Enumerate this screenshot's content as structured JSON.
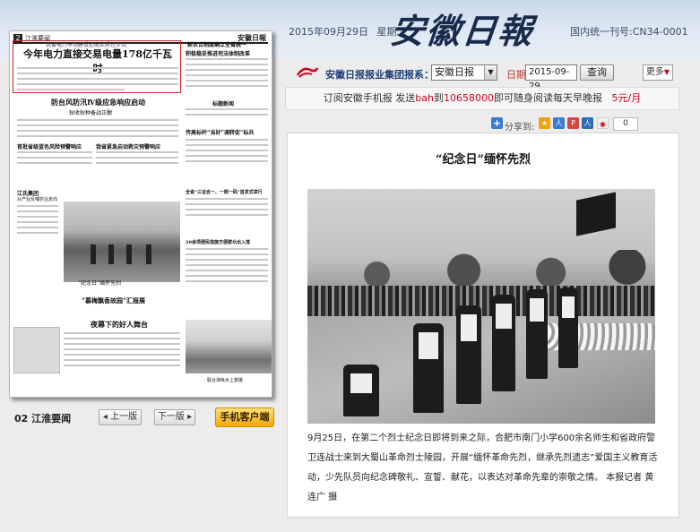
{
  "header": {
    "date": "2015年09月29日",
    "weekday": "星期二",
    "masthead": "安徽日報",
    "issn": "国内统一刊号:CN34-0001"
  },
  "thumbnail": {
    "page_num": "2",
    "section": "江淮要闻",
    "brand": "安徽日報",
    "kicker": "我省电力市场建设迈出实质性步伐",
    "headlines": [
      "今年电力直接交易电量178亿千瓦时",
      "防台风防汛Ⅳ级应急响应启动",
      "秋收秋种备战正酣",
      "我省紧急启动救灾预警响应",
      "首批省级蓝色风险预警响应",
      "江氏集团",
      "从产业反哺农业走向",
      "“慕梅飘香故园”汇报展",
      "夜幕下的好人舞台",
      "“纪念日”缅怀先烈",
      "新农合制度确立全省统一",
      "积极稳妥推进司法体制改革",
      "标题新闻",
      "传高标杆“当好”调转促”标兵",
      "全省“三证合一、一照一码”首发式举行",
      "20余项便民措施方便群众出入境",
      "联合演练水上救援"
    ]
  },
  "leftnav": {
    "page_label": "02 江淮要闻",
    "prev": "上一版",
    "next": "下一版",
    "mobile": "手机客户端"
  },
  "toolbar": {
    "group_label": "安徽日报报业集团报系：",
    "paper_selected": "安徽日报",
    "date_label": "日期",
    "date_value": "2015-09-29",
    "query": "查询",
    "more": "更多"
  },
  "subscribe": {
    "prefix": "订阅安徽手机报  发送",
    "code": "bah",
    "to": "到",
    "number": "10658000",
    "suffix": "即可随身阅读每天早晚报",
    "price": "5元/月"
  },
  "share": {
    "label": "分享到:",
    "count": "0",
    "colors": [
      "#f0a30a",
      "#3a7bd5",
      "#d64541",
      "#e08a00",
      "#2d6db5",
      "#d0021b"
    ]
  },
  "article": {
    "title": "“纪念日”缅怀先烈",
    "body": "9月25日，在第二个烈士纪念日即将到来之际，合肥市南门小学600余名师生和省政府警卫连战士来到大蜀山革命烈士陵园，开展“缅怀革命先烈，继承先烈遗志”爱国主义教育活动，少先队员向纪念碑敬礼、宣誓、献花，以表达对革命先辈的崇敬之情。  本报记者 黄连广 摄"
  }
}
